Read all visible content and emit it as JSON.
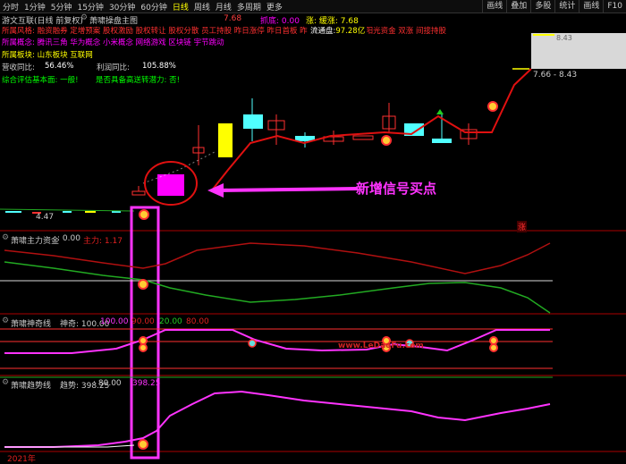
{
  "toolbar": {
    "items": [
      "分时",
      "1分钟",
      "5分钟",
      "15分钟",
      "30分钟",
      "60分钟",
      "日线",
      "周线",
      "月线",
      "多周期",
      "更多"
    ],
    "active_index": 6,
    "right_buttons": [
      "画线",
      "叠加",
      "多股",
      "统计",
      "画线",
      "F10"
    ]
  },
  "header": {
    "stock": "游文互联(日线 前复权)",
    "indicator": "萧啸操盘主图",
    "price": "7.68",
    "flag": "抓底: 0.00",
    "rise": "涨: 缓涨: 7.68"
  },
  "info": {
    "risk_line": "所属风格: 融资融券 定增预案 股权激励 股权转让 股权分散 员工持股 昨日涨停 昨日首板 昨日上榜 融资融券 阳光资金 双涨 间接持股",
    "circ_label": "流通盘:",
    "circ_value": "97.28亿",
    "concept_line": "所属概念: 腾讯三角 华为概念 小米概念 网络游戏 区块链 宇节跳动",
    "sector_line": "所属板块: 山东板块 互联网",
    "revenue_label": "营收同比:",
    "revenue_value": "56.46%",
    "profit_label": "利润同比:",
    "profit_value": "105.88%",
    "eval_label": "综合评估基本面: 一般!",
    "bull_label": "是否具备高送转潜力: 否!"
  },
  "main_chart": {
    "annotation": "新增信号买点",
    "low_label": "4.47",
    "high_label_top": "8.43",
    "range_label": "7.66 - 8.43",
    "up_badge": "涨"
  },
  "panel1": {
    "title": "萧啸主力资金",
    "value": ": 0.00",
    "sub_label": "主力: 1.17"
  },
  "panel2": {
    "title": "萧啸神奇线",
    "value_label": "神奇: 100.00",
    "v1": "100.00",
    "v2": "90.00",
    "v3": "20.00",
    "v4": "80.00",
    "watermark": "www.LeDaoFu.com"
  },
  "panel3": {
    "title": "萧啸趋势线",
    "value_label": "趋势: 398.25",
    "v1": ": 80.00",
    "v2": "398.25"
  },
  "footer": {
    "year": "2021年"
  },
  "colors": {
    "background": "#000000",
    "up_candle": "#ff3030",
    "down_candle": "#50ffff",
    "ma_red": "#e01010",
    "magenta": "#ff00ff",
    "yellow": "#ffff00",
    "cyan": "#00ffff",
    "green": "#22aa22"
  }
}
